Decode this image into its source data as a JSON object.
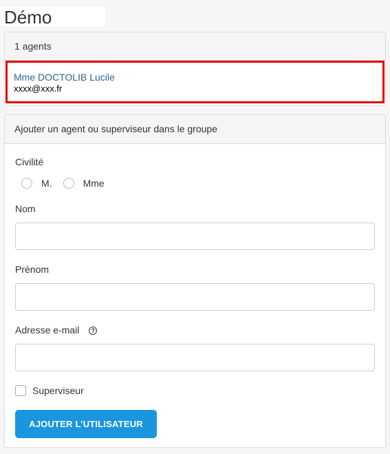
{
  "page": {
    "title": "Démo"
  },
  "agents_panel": {
    "count_text": "1 agents",
    "agents": [
      {
        "name": "Mme DOCTOLIB Lucile",
        "email": "xxxx@xxx.fr"
      }
    ]
  },
  "form": {
    "header": "Ajouter un agent ou superviseur dans le groupe",
    "civility_label": "Civilité",
    "civility_options": [
      "M.",
      "Mme"
    ],
    "name_label": "Nom",
    "firstname_label": "Prénom",
    "email_label": "Adresse e-mail",
    "supervisor_label": "Superviseur",
    "submit_label": "AJOUTER L’UTILISATEUR"
  },
  "colors": {
    "accent": "#1a96e0",
    "highlight": "#e00000",
    "link": "#2a6496"
  },
  "icons": {
    "email_help": "question-circle-icon"
  }
}
